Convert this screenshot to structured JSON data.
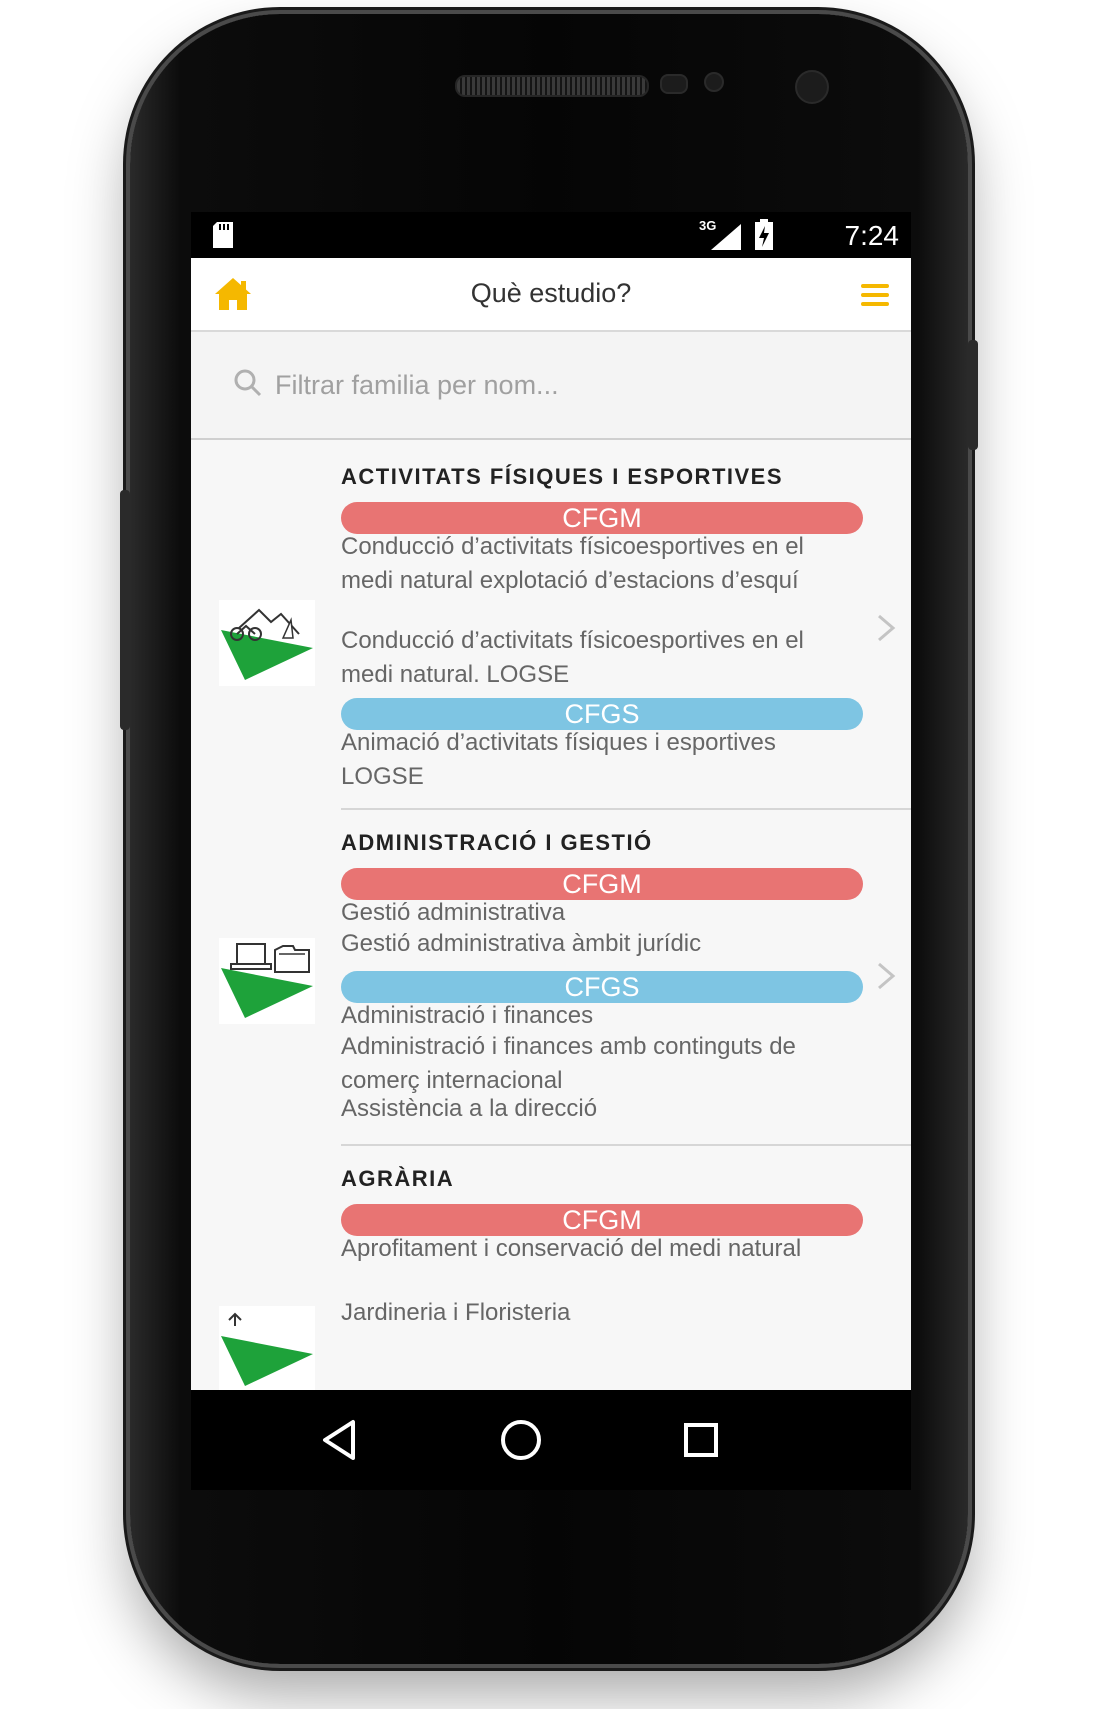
{
  "status_bar": {
    "time": "7:24",
    "network": "3G"
  },
  "app_bar": {
    "title": "Què estudio?",
    "icons": {
      "home": "home-icon",
      "menu": "menu-icon"
    },
    "accent_color": "#f5b800"
  },
  "search": {
    "placeholder": "Filtrar familia per nom..."
  },
  "colors": {
    "cfgm": "#e87473",
    "cfgs": "#7ec5e3"
  },
  "families": [
    {
      "title": "ACTIVITATS FÍSIQUES I ESPORTIVES",
      "icon": "sports-family-icon",
      "groups": [
        {
          "label": "CFGM",
          "courses": [
            "Conducció d’activitats físicoesportives en el medi natural explotació d’estacions d’esquí",
            "Conducció d’activitats físicoesportives en el medi natural. LOGSE"
          ]
        },
        {
          "label": "CFGS",
          "courses": [
            "Animació d’activitats físiques i esportives LOGSE"
          ]
        }
      ]
    },
    {
      "title": "ADMINISTRACIÓ I GESTIÓ",
      "icon": "administration-family-icon",
      "groups": [
        {
          "label": "CFGM",
          "courses": [
            "Gestió administrativa",
            "Gestió administrativa àmbit jurídic"
          ]
        },
        {
          "label": "CFGS",
          "courses": [
            "Administració i finances",
            "Administració i finances amb continguts de comerç internacional",
            "Assistència a la direcció"
          ]
        }
      ]
    },
    {
      "title": "AGRÀRIA",
      "icon": "agriculture-family-icon",
      "groups": [
        {
          "label": "CFGM",
          "courses": [
            "Aprofitament i conservació del medi natural",
            "Jardineria i Floristeria"
          ]
        }
      ]
    }
  ]
}
